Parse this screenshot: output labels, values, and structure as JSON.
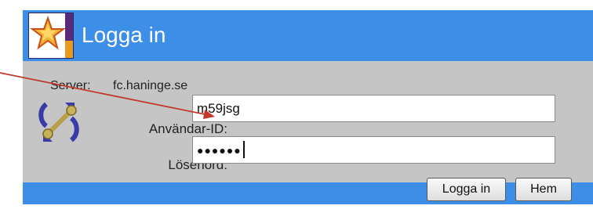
{
  "window": {
    "title": "Logga in"
  },
  "server": {
    "label": "Server:",
    "value": "fc.haninge.se"
  },
  "form": {
    "user_label": "Användar-ID:",
    "user_value": "m59jsg",
    "password_label": "Lösenord:",
    "password_value": "●●●●●●"
  },
  "buttons": {
    "login_label": "Logga in",
    "home_label": "Hem"
  },
  "icons": {
    "logo": "star-logo-icon",
    "key": "key-icon"
  },
  "colors": {
    "title_bar": "#3c8ee7",
    "panel": "#c5c5c5",
    "annotation_arrow": "#c0392b"
  }
}
